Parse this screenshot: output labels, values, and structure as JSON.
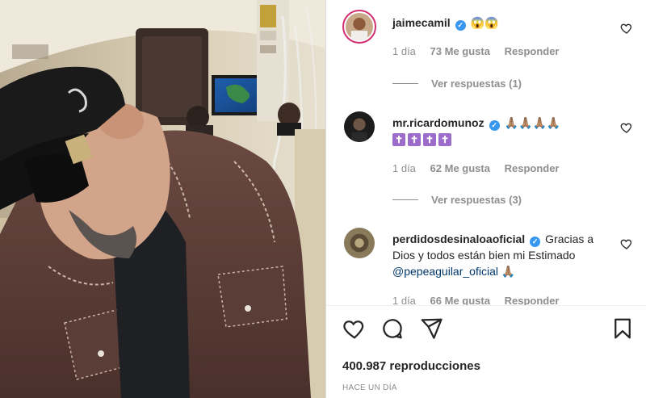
{
  "comments": [
    {
      "username": "jaimecamil",
      "verified": true,
      "text": "😱😱",
      "time": "1 día",
      "likes": "73 Me gusta",
      "reply": "Responder",
      "view_replies": "Ver respuestas (1)"
    },
    {
      "username": "mr.ricardomunoz",
      "verified": true,
      "text": "🙏🏽🙏🏽🙏🏽🙏🏽",
      "crosses": [
        "✝",
        "✝",
        "✝",
        "✝"
      ],
      "time": "1 día",
      "likes": "62 Me gusta",
      "reply": "Responder",
      "view_replies": "Ver respuestas (3)"
    },
    {
      "username": "perdidosdesinaloaoficial",
      "verified": true,
      "text_before": "Gracias a Dios y todos están bien mi Estimado ",
      "mention": "@pepeaguilar_oficial",
      "text_after": " 🙏🏽",
      "time": "1 día",
      "likes": "66 Me gusta",
      "reply": "Responder"
    }
  ],
  "footer": {
    "views": "400.987 reproducciones",
    "time_ago": "HACE UN DÍA"
  },
  "icons": {
    "like": "heart-icon",
    "comment": "comment-icon",
    "share": "paper-plane-icon",
    "save": "bookmark-icon",
    "verified": "verified-badge-icon"
  },
  "colors": {
    "verified": "#3897f0",
    "mention": "#00376b",
    "muted": "#8e8e8e",
    "story_ring": "#d12f6f"
  }
}
